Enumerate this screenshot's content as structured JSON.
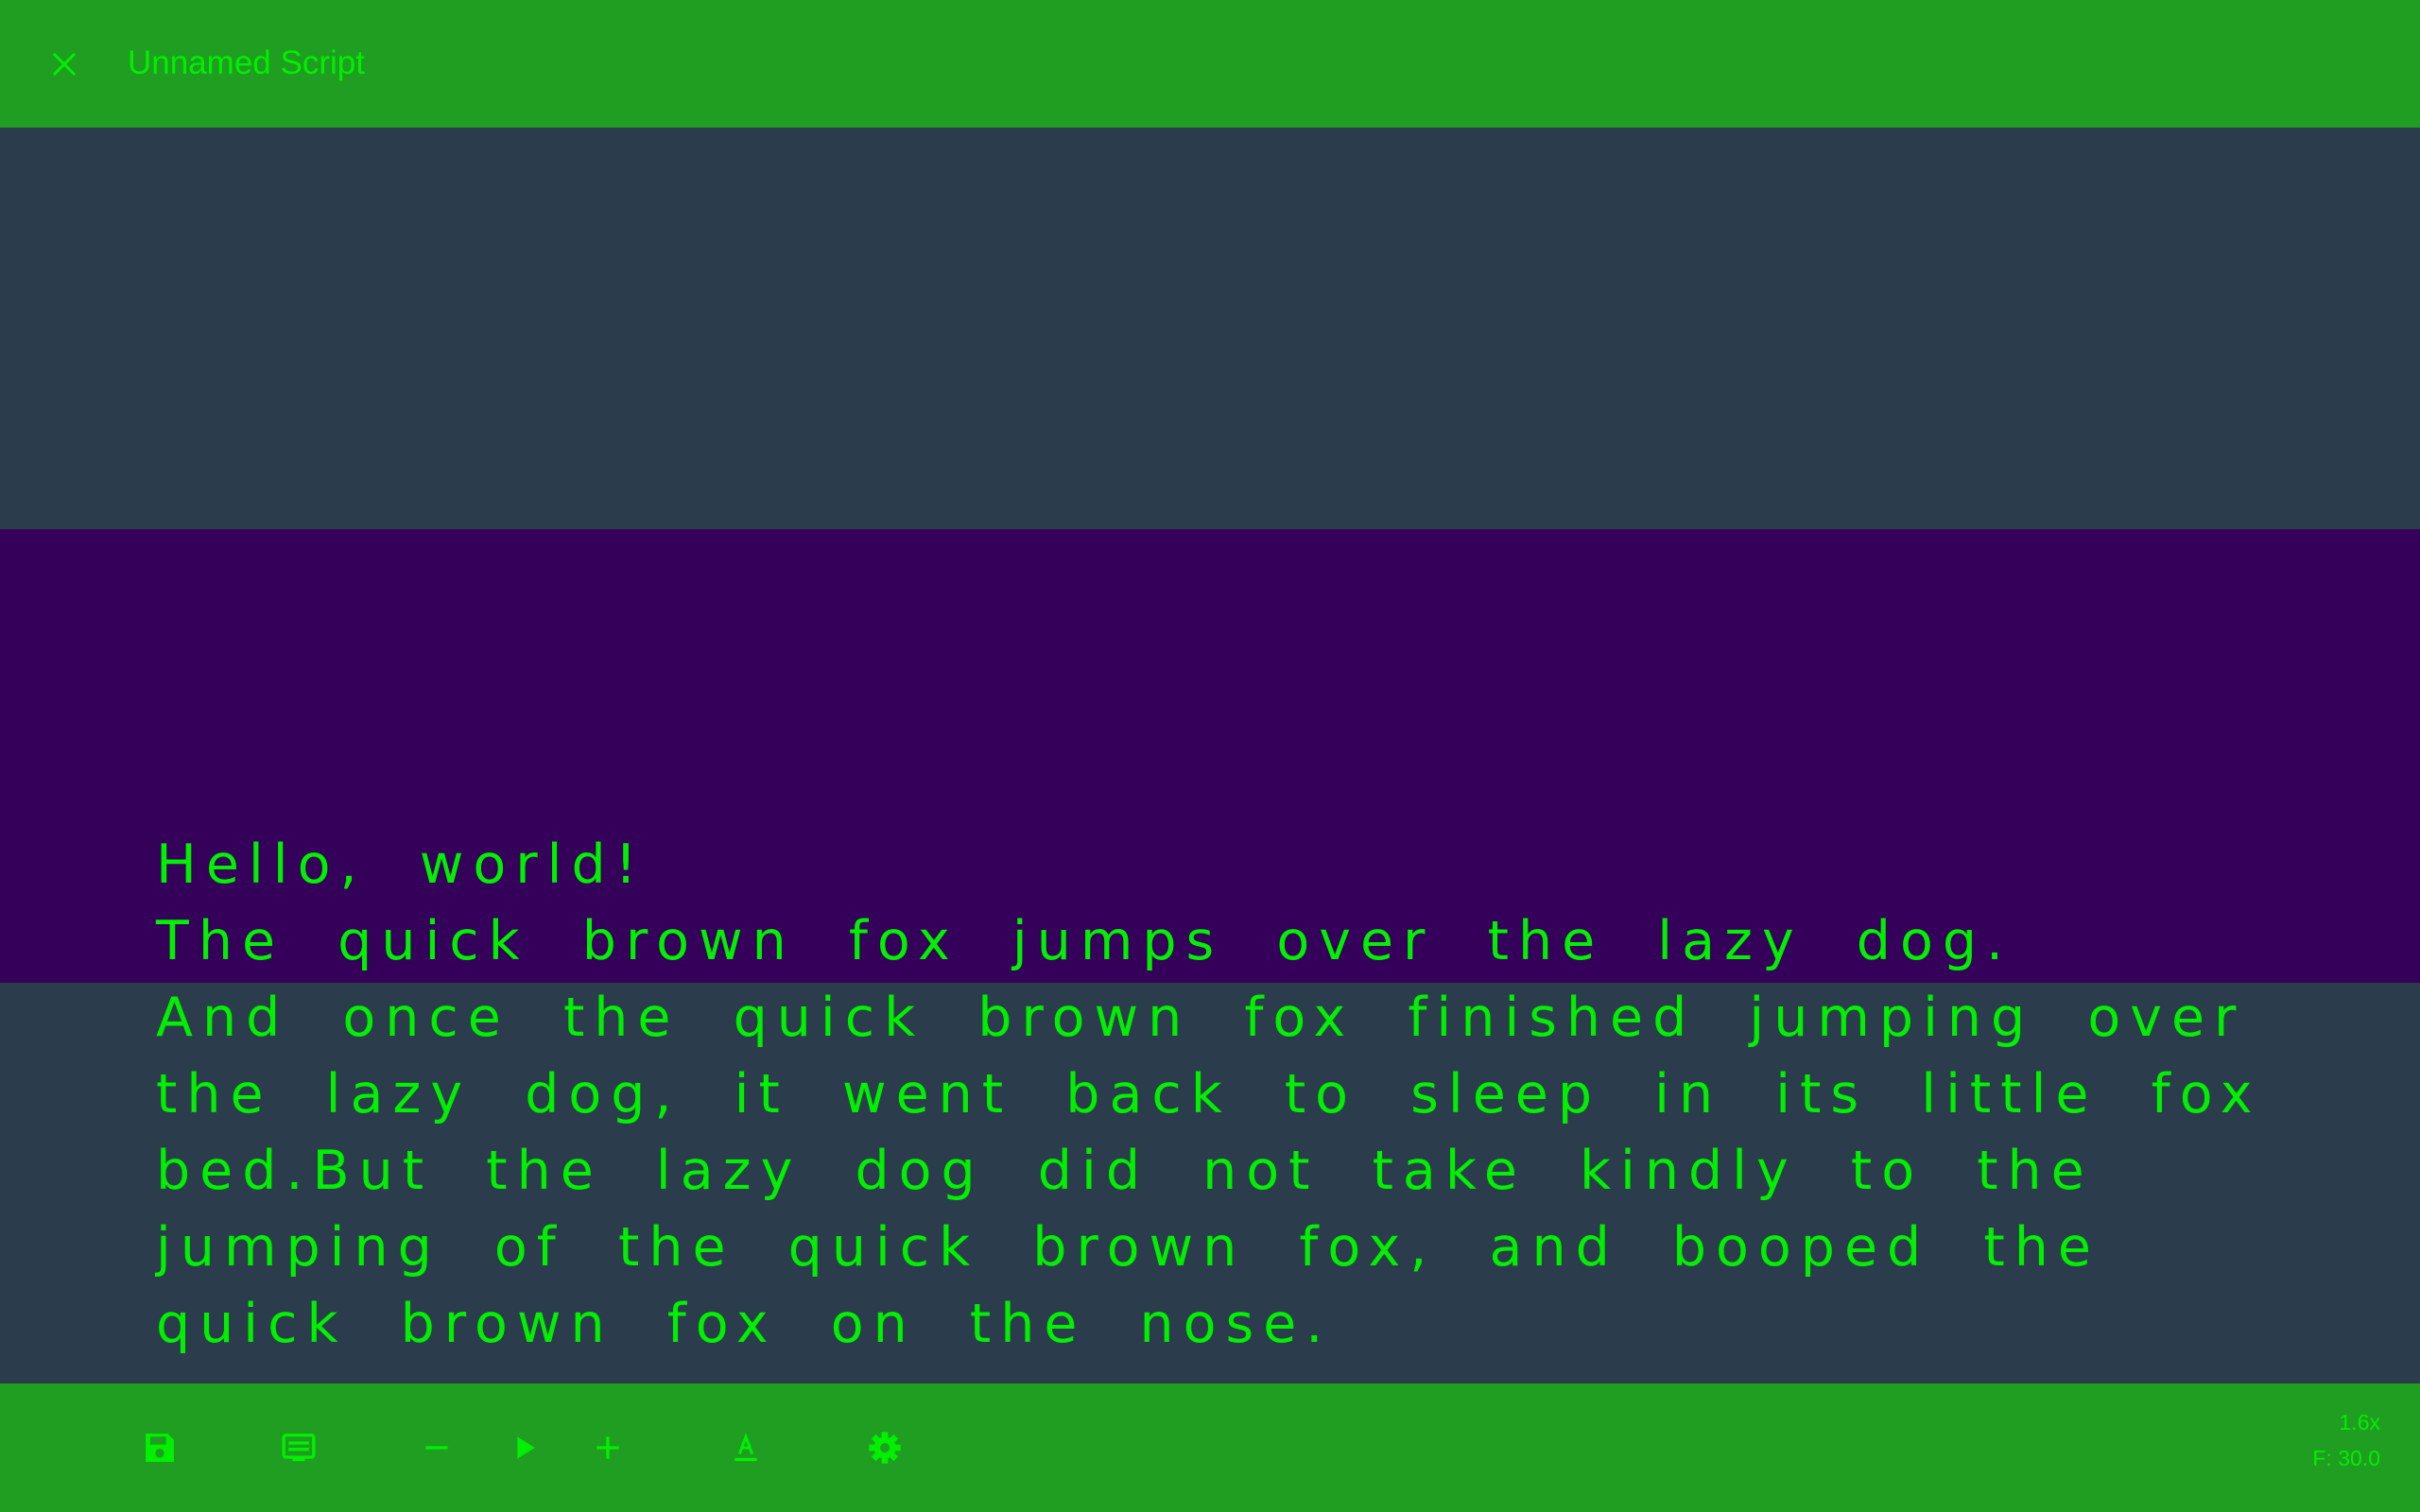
{
  "app": {
    "title": "Unnamed Script"
  },
  "script": {
    "line1": "Hello, world!",
    "line2": "The quick brown fox jumps over the lazy dog.",
    "body": "And once the quick brown fox finished jumping over the lazy dog, it went back to sleep in its little fox bed.But the lazy dog did not take kindly to the jumping of the quick brown fox, and booped the quick brown fox on the nose."
  },
  "toolbar": {
    "icons": [
      "save-icon",
      "subtitles-icon",
      "minus-icon",
      "play-icon",
      "plus-icon",
      "text-format-icon",
      "gear-icon"
    ],
    "speed": "1.6x",
    "font_size": "F: 30.0"
  },
  "colors": {
    "accent_bar": "#209e22",
    "text": "#00f000",
    "background": "#2b3d4c",
    "reading_band": "#340059"
  }
}
